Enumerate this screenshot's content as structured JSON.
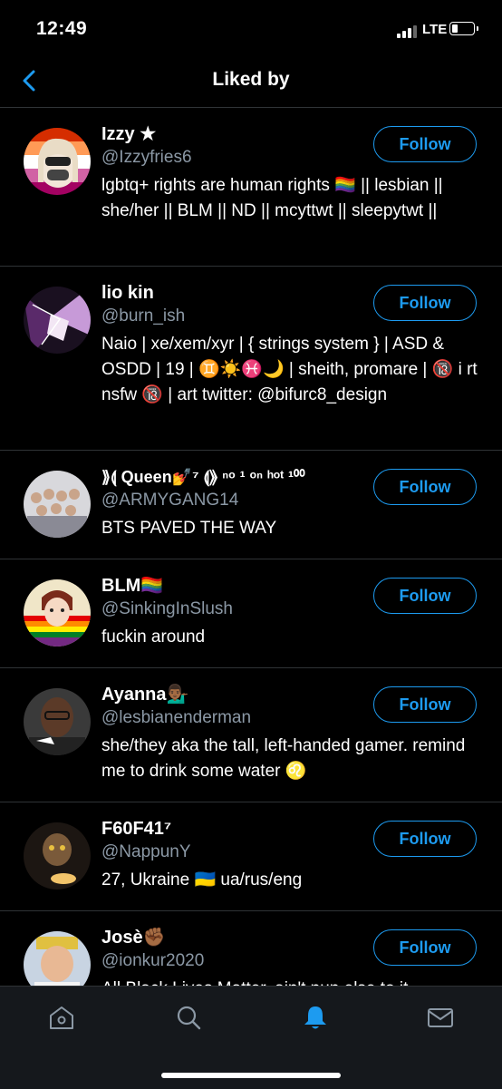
{
  "status": {
    "time": "12:49",
    "network": "LTE"
  },
  "header": {
    "title": "Liked by"
  },
  "follow_label": "Follow",
  "users": [
    {
      "name": "Izzy ★",
      "handle": "@Izzyfries6",
      "bio": "lgbtq+ rights are human rights 🏳️‍🌈 || lesbian || she/her || BLM || ND || mcyttwt || sleepytwt ||"
    },
    {
      "name": "lio kin",
      "handle": "@burn_ish",
      "bio": "Naio | xe/xem/xyr | { strings system } | ASD & OSDD | 19 | ♊☀️♓🌙 | sheith, promare | 🔞 i rt nsfw 🔞 | art twitter: @bifurc8_design"
    },
    {
      "name": "⟫⟬ Queen💅⁷ ⟬⟫ ⁿᵒ ¹ ᵒⁿ ʰᵒᵗ ¹⁰⁰",
      "handle": "@ARMYGANG14",
      "bio": "BTS PAVED THE WAY"
    },
    {
      "name": "BLM🏳️‍🌈",
      "handle": "@SinkingInSlush",
      "bio": "fuckin around"
    },
    {
      "name": "Ayanna💁🏾‍♂️",
      "handle": "@lesbianenderman",
      "bio": "she/they aka the tall, left-handed gamer. remind me to drink some water ♌"
    },
    {
      "name": "F60F41⁷",
      "handle": "@NappunY",
      "bio": "27, Ukraine 🇺🇦 ua/rus/eng"
    },
    {
      "name": "Josè✊🏾",
      "handle": "@ionkur2020",
      "bio": "All Black Lives Matter, ain't nun else to it"
    }
  ],
  "tabs": [
    "home-icon",
    "search-icon",
    "notifications-icon",
    "messages-icon"
  ],
  "colors": {
    "accent": "#1d9bf0",
    "background": "#000000",
    "secondary_text": "#8b98a5",
    "divider": "#2f3336"
  }
}
